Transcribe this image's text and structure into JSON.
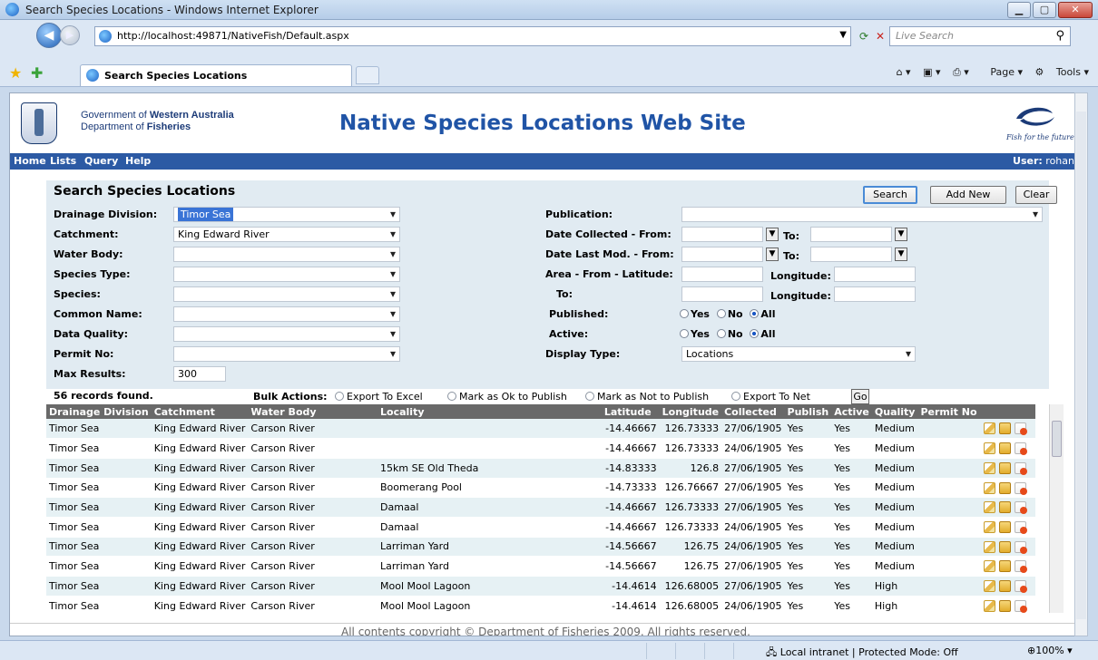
{
  "window": {
    "title": "Search Species Locations - Windows Internet Explorer",
    "url": "http://localhost:49871/NativeFish/Default.aspx",
    "search_placeholder": "Live Search",
    "tab_title": "Search Species Locations",
    "cmd_page": "Page",
    "cmd_tools": "Tools"
  },
  "header": {
    "gov_line1_prefix": "Government of ",
    "gov_line1_bold": "Western Australia",
    "gov_line2_prefix": "Department of ",
    "gov_line2_bold": "Fisheries",
    "site_title": "Native Species Locations Web Site",
    "tagline": "Fish for the future"
  },
  "menu": {
    "items": [
      "Home",
      "Lists",
      "Query",
      "Help"
    ],
    "user_label": "User:",
    "user_name": "rohan"
  },
  "search": {
    "title": "Search Species Locations",
    "buttons": {
      "search": "Search",
      "add_new": "Add New",
      "clear": "Clear"
    },
    "left_fields": [
      {
        "label": "Drainage Division:",
        "value": "Timor Sea"
      },
      {
        "label": "Catchment:",
        "value": "King Edward River"
      },
      {
        "label": "Water Body:",
        "value": ""
      },
      {
        "label": "Species Type:",
        "value": ""
      },
      {
        "label": "Species:",
        "value": ""
      },
      {
        "label": "Common Name:",
        "value": ""
      },
      {
        "label": "Data Quality:",
        "value": ""
      },
      {
        "label": "Permit No:",
        "value": ""
      }
    ],
    "max_results_label": "Max Results:",
    "max_results_value": "300",
    "publication_label": "Publication:",
    "publication_value": "",
    "date_collected_label": "Date Collected - From:",
    "date_last_mod_label": "Date Last Mod. - From:",
    "to_label": "To:",
    "area_from_label": "Area - From - Latitude:",
    "area_to_label": "To:",
    "longitude_label": "Longitude:",
    "published_label": "Published:",
    "active_label": "Active:",
    "radio_yes": "Yes",
    "radio_no": "No",
    "radio_all": "All",
    "display_type_label": "Display Type:",
    "display_type_value": "Locations"
  },
  "bulk": {
    "records_found": "56 records found.",
    "label": "Bulk Actions:",
    "options": [
      "Export To Excel",
      "Mark as Ok to Publish",
      "Mark as Not to Publish",
      "Export To Net"
    ],
    "go": "Go"
  },
  "table": {
    "columns": [
      "Drainage Division",
      "Catchment",
      "Water Body",
      "Locality",
      "Latitude",
      "Longitude",
      "Collected",
      "Publish",
      "Active",
      "Quality",
      "Permit No",
      ""
    ],
    "rows": [
      [
        "Timor Sea",
        "King Edward River",
        "Carson River",
        "",
        "-14.46667",
        "126.73333",
        "27/06/1905",
        "Yes",
        "Yes",
        "Medium",
        ""
      ],
      [
        "Timor Sea",
        "King Edward River",
        "Carson River",
        "",
        "-14.46667",
        "126.73333",
        "24/06/1905",
        "Yes",
        "Yes",
        "Medium",
        ""
      ],
      [
        "Timor Sea",
        "King Edward River",
        "Carson River",
        "15km SE Old Theda",
        "-14.83333",
        "126.8",
        "27/06/1905",
        "Yes",
        "Yes",
        "Medium",
        ""
      ],
      [
        "Timor Sea",
        "King Edward River",
        "Carson River",
        "Boomerang Pool",
        "-14.73333",
        "126.76667",
        "27/06/1905",
        "Yes",
        "Yes",
        "Medium",
        ""
      ],
      [
        "Timor Sea",
        "King Edward River",
        "Carson River",
        "Damaal",
        "-14.46667",
        "126.73333",
        "27/06/1905",
        "Yes",
        "Yes",
        "Medium",
        ""
      ],
      [
        "Timor Sea",
        "King Edward River",
        "Carson River",
        "Damaal",
        "-14.46667",
        "126.73333",
        "24/06/1905",
        "Yes",
        "Yes",
        "Medium",
        ""
      ],
      [
        "Timor Sea",
        "King Edward River",
        "Carson River",
        "Larriman Yard",
        "-14.56667",
        "126.75",
        "24/06/1905",
        "Yes",
        "Yes",
        "Medium",
        ""
      ],
      [
        "Timor Sea",
        "King Edward River",
        "Carson River",
        "Larriman Yard",
        "-14.56667",
        "126.75",
        "27/06/1905",
        "Yes",
        "Yes",
        "Medium",
        ""
      ],
      [
        "Timor Sea",
        "King Edward River",
        "Carson River",
        "Mool Mool Lagoon",
        "-14.4614",
        "126.68005",
        "27/06/1905",
        "Yes",
        "Yes",
        "High",
        ""
      ],
      [
        "Timor Sea",
        "King Edward River",
        "Carson River",
        "Mool Mool Lagoon",
        "-14.4614",
        "126.68005",
        "24/06/1905",
        "Yes",
        "Yes",
        "High",
        ""
      ]
    ]
  },
  "footer": "All contents copyright © Department of Fisheries 2009. All rights reserved.",
  "status": {
    "zone": "Local intranet | Protected Mode: Off",
    "zoom": "100%"
  }
}
